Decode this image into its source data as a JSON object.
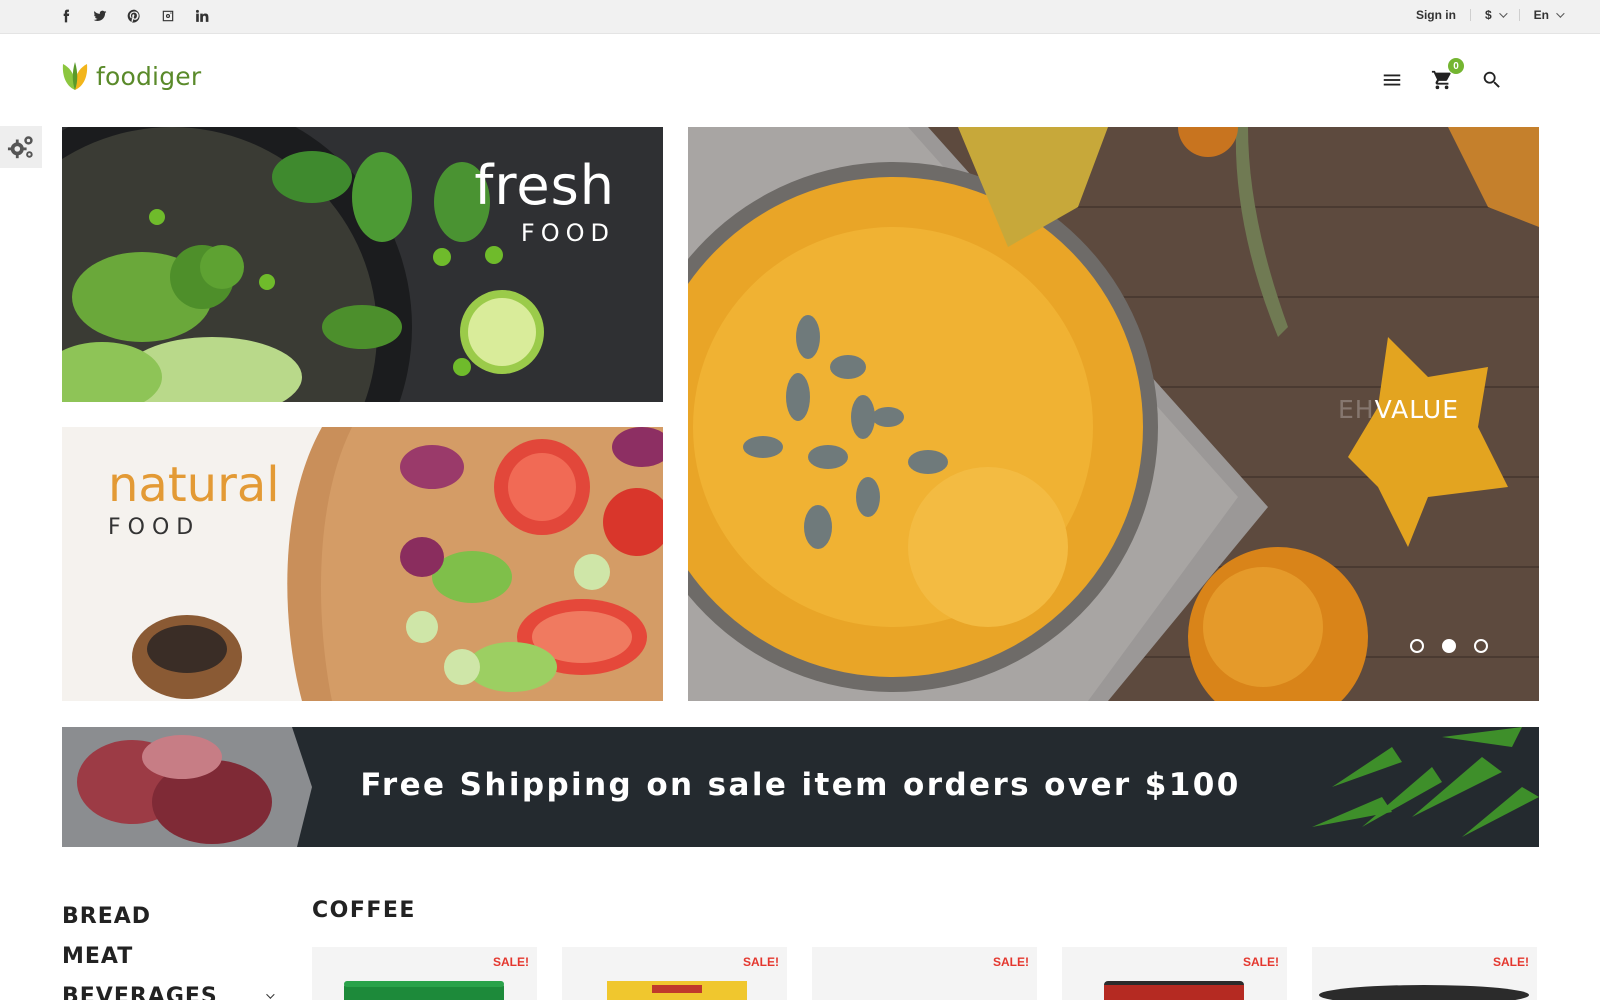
{
  "topbar": {
    "social": [
      "facebook-icon",
      "twitter-icon",
      "pinterest-icon",
      "instagram-icon",
      "linkedin-icon"
    ],
    "sign_in": "Sign in",
    "currency": "$",
    "language": "En"
  },
  "header": {
    "logo_text": "foodiger",
    "cart_count": "0",
    "icons": [
      "menu-icon",
      "cart-icon",
      "search-icon"
    ]
  },
  "banners": {
    "fresh": {
      "title": "fresh",
      "subtitle": "FOOD"
    },
    "natural": {
      "title": "natural",
      "subtitle": "FOOD"
    },
    "slider": {
      "text_faded": "EH",
      "text": "VALUE",
      "slides": 3,
      "active_slide": 2
    }
  },
  "shipping": {
    "text": "Free Shipping on sale item orders over $100"
  },
  "categories": [
    "BREAD",
    "MEAT",
    "BEVERAGES"
  ],
  "section": {
    "title": "COFFEE"
  },
  "products": [
    {
      "badge": "SALE!"
    },
    {
      "badge": "SALE!"
    },
    {
      "badge": "SALE!"
    },
    {
      "badge": "SALE!"
    },
    {
      "badge": "SALE!"
    }
  ],
  "colors": {
    "brand_green": "#74b531",
    "accent_orange": "#e39a35",
    "sale_red": "#e4372e",
    "dark": "#222222"
  }
}
